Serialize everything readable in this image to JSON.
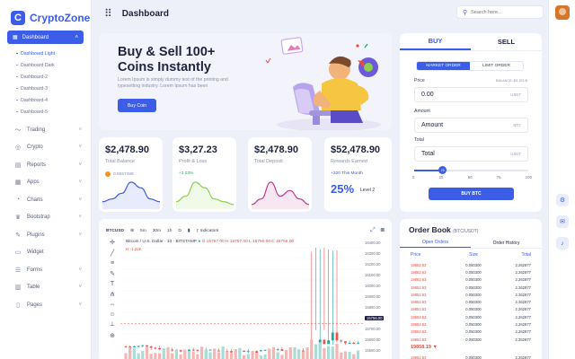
{
  "app": {
    "name": "CryptoZone",
    "logo_letter": "C"
  },
  "topbar": {
    "title": "Dashboard",
    "search_placeholder": "Search here..."
  },
  "sidebar": {
    "active": {
      "label": "Dashboard",
      "icon": "dashboard-icon"
    },
    "subitems": [
      {
        "label": "Dashboard Light",
        "current": true
      },
      {
        "label": "Dashboard Dark"
      },
      {
        "label": "Dashboard-2"
      },
      {
        "label": "Dashboard-3"
      },
      {
        "label": "Dashboard-4"
      },
      {
        "label": "Dashboard-5"
      }
    ],
    "items": [
      {
        "label": "Trading",
        "icon": "trend-icon",
        "glyph": "〜"
      },
      {
        "label": "Crypto",
        "icon": "crypto-icon",
        "glyph": "◎"
      },
      {
        "label": "Reports",
        "icon": "report-icon",
        "glyph": "▤"
      },
      {
        "label": "Apps",
        "icon": "apps-icon",
        "glyph": "▦"
      },
      {
        "label": "Charts",
        "icon": "chart-icon",
        "glyph": "◔"
      },
      {
        "label": "Bootstrap",
        "icon": "bootstrap-icon",
        "glyph": "♛"
      },
      {
        "label": "Plugins",
        "icon": "plugin-icon",
        "glyph": "✎"
      },
      {
        "label": "Widget",
        "icon": "widget-icon",
        "glyph": "▭",
        "no_chevron": true
      },
      {
        "label": "Forms",
        "icon": "form-icon",
        "glyph": "☰"
      },
      {
        "label": "Table",
        "icon": "table-icon",
        "glyph": "▥"
      },
      {
        "label": "Pages",
        "icon": "pages-icon",
        "glyph": "▯"
      }
    ]
  },
  "hero": {
    "title_line1": "Buy & Sell 100+",
    "title_line2": "Coins Instantly",
    "text": "Lorem Ipsum is simply dummy text of the printing and typesetting industry. Lorem Ipsum has been",
    "button": "Buy Coin"
  },
  "stats": [
    {
      "value": "$2,478.90",
      "label": "Total Balance",
      "sub": "0.5657488",
      "sub_icon": "bitcoin-icon",
      "spark_color": "#3b5de7",
      "spark": [
        2,
        3,
        5,
        9,
        7,
        3,
        2
      ]
    },
    {
      "value": "$3,27.23",
      "label": "Profit & Loss",
      "sub": "+3.03%",
      "sub_color": "#1bb56b",
      "spark_color": "#8ccf4d",
      "spark": [
        2,
        4,
        9,
        7,
        3,
        2,
        1
      ]
    },
    {
      "value": "$2,478.90",
      "label": "Total Deposit",
      "sub": "",
      "spark_color": "#c43a8e",
      "spark": [
        1,
        3,
        9,
        4,
        6,
        3,
        1
      ]
    },
    {
      "value": "$52,478.90",
      "label": "Rewards Earned",
      "sub": "+200 This Month",
      "sub_color": "#3b5de7",
      "percent": "25%",
      "level": "Level 2"
    }
  ],
  "trade": {
    "tabs": [
      "BUY",
      "SELL"
    ],
    "order_types": [
      "MARKET ORDER",
      "LIMIT ORDER"
    ],
    "price_label": "Price",
    "balance_label": "BALANCE: $3,123 B",
    "price_value": "0.00",
    "price_unit": "USDT",
    "amount_label": "Amount",
    "amount_placeholder": "Amount",
    "amount_unit": "BTC",
    "total_label": "Total",
    "total_placeholder": "Total",
    "total_unit": "USDT",
    "slider_value": 25,
    "slider_ticks": [
      "0",
      "25",
      "50",
      "75",
      "100"
    ],
    "button": "BUY BTC"
  },
  "chart": {
    "symbol": "BTCUSD",
    "intervals": [
      "5m",
      "30m",
      "1h",
      "D"
    ],
    "indicators": "Indicators",
    "title": "Bitcoin / U.S. Dollar · 10 · BITSTAMP",
    "ohlc": "O 15757.00  H 15757.00  L 15750.00  C 15756.00",
    "change": "H -1.22K",
    "y_labels": [
      "16400.00",
      "16300.00",
      "16200.00",
      "16100.00",
      "16000.00",
      "15900.00",
      "15800.00",
      "15756.00",
      "15700.00",
      "15600.00",
      "15500.00"
    ],
    "y_highlight": "15756.00",
    "candles": [
      {
        "o": 15560,
        "c": 15560,
        "h": 15880,
        "l": 15450
      }
    ]
  },
  "order_book": {
    "title": "Order Book",
    "subtitle": "(BTC/USDT)",
    "tabs": [
      "Open Orders",
      "Order History"
    ],
    "headers": [
      "Price",
      "Size",
      "Total"
    ],
    "rows": [
      [
        "19852.63",
        "0.050300",
        "2.262877"
      ],
      [
        "19852.63",
        "0.050300",
        "2.262877"
      ],
      [
        "19852.63",
        "0.050300",
        "2.262877"
      ],
      [
        "19852.63",
        "0.050300",
        "2.262877"
      ],
      [
        "19852.63",
        "0.050300",
        "2.262877"
      ],
      [
        "19852.63",
        "0.050300",
        "2.262877"
      ],
      [
        "19852.63",
        "0.050300",
        "2.262877"
      ],
      [
        "19852.63",
        "0.050300",
        "2.262877"
      ],
      [
        "19852.63",
        "0.050300",
        "2.262877"
      ],
      [
        "19852.63",
        "0.050300",
        "2.262877"
      ],
      [
        "19852.63",
        "0.050300",
        "2.262877"
      ]
    ],
    "last_price": "19858.19 ▼",
    "rows_after": [
      [
        "19852.63",
        "0.050300",
        "2.262877"
      ]
    ]
  },
  "rail": {
    "buttons": [
      "settings-icon",
      "mail-icon",
      "bell-icon"
    ]
  }
}
